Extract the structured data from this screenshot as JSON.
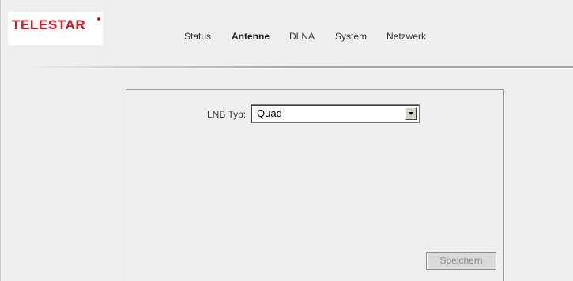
{
  "brand": {
    "logo_text": "TELESTAR",
    "color": "#d01921"
  },
  "nav": {
    "items": [
      {
        "label": "Status",
        "active": false
      },
      {
        "label": "Antenne",
        "active": true
      },
      {
        "label": "DLNA",
        "active": false
      },
      {
        "label": "System",
        "active": false
      },
      {
        "label": "Netzwerk",
        "active": false
      }
    ]
  },
  "form": {
    "lnb_label": "LNB Typ:",
    "lnb_value": "Quad",
    "lnb_icon": "chevron-down-icon",
    "save_label": "Speichern",
    "save_enabled": false
  },
  "colors": {
    "background": "#efefef",
    "text": "#333333",
    "disabled_text": "#8a8a8a"
  }
}
